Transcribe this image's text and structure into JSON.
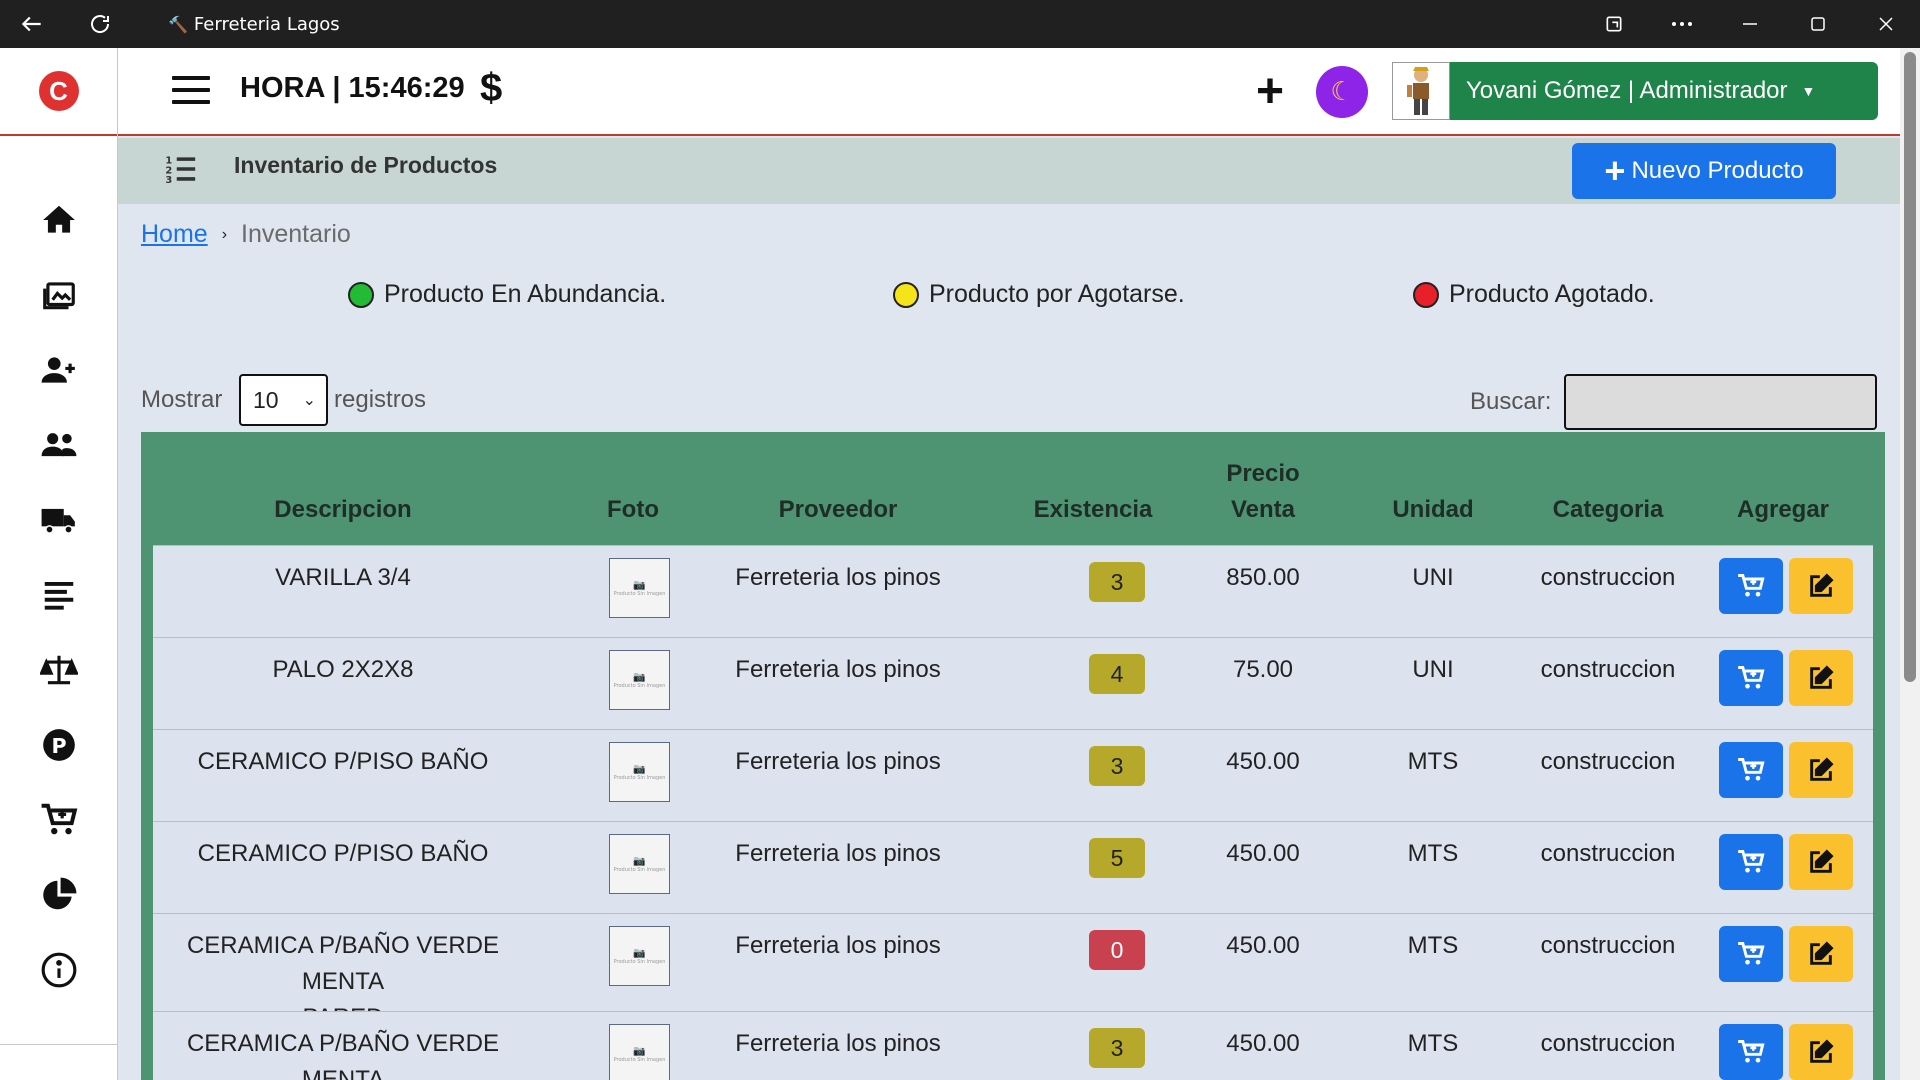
{
  "window": {
    "title": "Ferreteria Lagos",
    "favicon": "hammer-icon",
    "buttons": [
      "back-icon",
      "reload-icon",
      "app-icon",
      "more-icon",
      "minimize-icon",
      "maximize-icon",
      "close-icon"
    ]
  },
  "sidebar": {
    "brand_letter": "C",
    "brand_color": "#e03131",
    "items": [
      {
        "name": "home",
        "icon": "home-icon"
      },
      {
        "name": "gallery",
        "icon": "images-icon"
      },
      {
        "name": "add-user",
        "icon": "user-plus-icon"
      },
      {
        "name": "users",
        "icon": "users-icon"
      },
      {
        "name": "suppliers",
        "icon": "truck-icon"
      },
      {
        "name": "list",
        "icon": "align-left-icon"
      },
      {
        "name": "balance",
        "icon": "scale-icon"
      },
      {
        "name": "parking",
        "icon": "p-circle-icon"
      },
      {
        "name": "cart",
        "icon": "cart-plus-icon"
      },
      {
        "name": "reports",
        "icon": "pie-chart-icon"
      },
      {
        "name": "info",
        "icon": "info-icon"
      }
    ]
  },
  "navbar": {
    "clock": "HORA | 15:46:29",
    "currency_symbol": "$",
    "plus_symbol": "+",
    "moon_icon": "moon-icon",
    "theme_color": "#8e24e8",
    "user_label": "Yovani Gómez | Administrador",
    "user_color": "#1e8449"
  },
  "header": {
    "title": "Inventario de Productos",
    "new_button": "Nuevo Producto",
    "new_button_color": "#1a73e8"
  },
  "breadcrumb": {
    "home": "Home",
    "separator": "›",
    "current": "Inventario"
  },
  "legend": [
    {
      "label": "Producto En Abundancia.",
      "color": "#22bb33"
    },
    {
      "label": "Producto por Agotarse.",
      "color": "#f5e41a"
    },
    {
      "label": "Producto Agotado.",
      "color": "#e8202a"
    }
  ],
  "controls": {
    "show_label": "Mostrar",
    "page_size": "10",
    "records_label": "registros",
    "search_label": "Buscar:",
    "search_value": ""
  },
  "table": {
    "header_color": "#4e9472",
    "columns": [
      "Descripcion",
      "Foto",
      "Proveedor",
      "Existencia",
      "Precio Venta",
      "Unidad",
      "Categoria",
      "Agregar"
    ],
    "precio_line1": "Precio",
    "precio_line2": "Venta",
    "photo_placeholder": "Producto Sin Imagen",
    "rows": [
      {
        "descripcion_1": "VARILLA 3/4",
        "descripcion_2": "",
        "proveedor": "Ferreteria los pinos",
        "existencia": "3",
        "stock_level": "low",
        "precio": "850.00",
        "unidad": "UNI",
        "categoria": "construccion"
      },
      {
        "descripcion_1": "PALO 2X2X8",
        "descripcion_2": "",
        "proveedor": "Ferreteria los pinos",
        "existencia": "4",
        "stock_level": "low",
        "precio": "75.00",
        "unidad": "UNI",
        "categoria": "construccion"
      },
      {
        "descripcion_1": "CERAMICO P/PISO BAÑO",
        "descripcion_2": "",
        "proveedor": "Ferreteria los pinos",
        "existencia": "3",
        "stock_level": "low",
        "precio": "450.00",
        "unidad": "MTS",
        "categoria": "construccion"
      },
      {
        "descripcion_1": "CERAMICO P/PISO BAÑO",
        "descripcion_2": "",
        "proveedor": "Ferreteria los pinos",
        "existencia": "5",
        "stock_level": "low",
        "precio": "450.00",
        "unidad": "MTS",
        "categoria": "construccion"
      },
      {
        "descripcion_1": "CERAMICA P/BAÑO VERDE MENTA",
        "descripcion_2": "PARED",
        "proveedor": "Ferreteria los pinos",
        "existencia": "0",
        "stock_level": "out",
        "precio": "450.00",
        "unidad": "MTS",
        "categoria": "construccion"
      },
      {
        "descripcion_1": "CERAMICA P/BAÑO VERDE MENTA",
        "descripcion_2": "",
        "proveedor": "Ferreteria los pinos",
        "existencia": "3",
        "stock_level": "low",
        "precio": "450.00",
        "unidad": "MTS",
        "categoria": "construccion"
      }
    ],
    "badge_colors": {
      "low": "#b5a82a",
      "out": "#c9404f"
    },
    "cart_icon": "cart-plus-icon",
    "edit_icon": "edit-icon"
  }
}
